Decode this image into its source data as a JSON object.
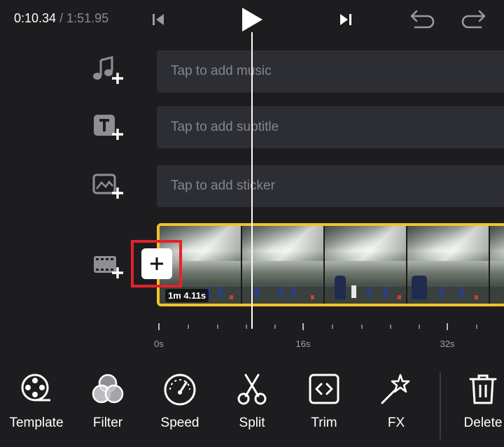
{
  "player": {
    "current_time": "0:10.34",
    "separator": " / ",
    "total_time": "1:51.95",
    "controls": [
      "skip-to-start-icon",
      "play-icon",
      "skip-to-end-icon",
      "undo-icon",
      "redo-icon"
    ]
  },
  "tracks": {
    "music": {
      "placeholder": "Tap to add music",
      "icon": "add-music-icon"
    },
    "subtitle": {
      "placeholder": "Tap to add subtitle",
      "icon": "add-text-icon"
    },
    "sticker": {
      "placeholder": "Tap to add sticker",
      "icon": "add-sticker-icon"
    },
    "video": {
      "icon": "add-video-track-icon"
    }
  },
  "clip": {
    "duration_label": "1m 4.11s",
    "frame_count": 5
  },
  "add_clip_button": {
    "icon": "plus-icon"
  },
  "ruler": {
    "labels": [
      "0s",
      "16s",
      "32s"
    ]
  },
  "toolbar": {
    "items": [
      {
        "label": "Template",
        "icon": "film-reel-icon"
      },
      {
        "label": "Filter",
        "icon": "filter-circles-icon"
      },
      {
        "label": "Speed",
        "icon": "speedometer-icon"
      },
      {
        "label": "Split",
        "icon": "scissors-icon"
      },
      {
        "label": "Trim",
        "icon": "trim-icon"
      },
      {
        "label": "FX",
        "icon": "magic-wand-icon"
      },
      {
        "label": "Delete",
        "icon": "trash-icon"
      }
    ]
  },
  "colors": {
    "background": "#1d1d20",
    "track_background": "#2d2e34",
    "clip_border": "#f3c12b",
    "highlight_border": "#e2232b",
    "placeholder_text": "#85868c"
  }
}
